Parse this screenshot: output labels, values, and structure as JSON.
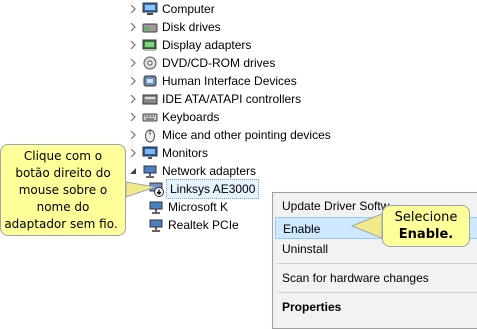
{
  "tree": {
    "items": [
      {
        "label": "Computer",
        "icon": "computer-icon",
        "expanded": false
      },
      {
        "label": "Disk drives",
        "icon": "disk-drive-icon",
        "expanded": false
      },
      {
        "label": "Display adapters",
        "icon": "display-adapter-icon",
        "expanded": false
      },
      {
        "label": "DVD/CD-ROM drives",
        "icon": "dvd-drive-icon",
        "expanded": false
      },
      {
        "label": "Human Interface Devices",
        "icon": "hid-icon",
        "expanded": false
      },
      {
        "label": "IDE ATA/ATAPI controllers",
        "icon": "ide-controller-icon",
        "expanded": false
      },
      {
        "label": "Keyboards",
        "icon": "keyboard-icon",
        "expanded": false
      },
      {
        "label": "Mice and other pointing devices",
        "icon": "mouse-icon",
        "expanded": false
      },
      {
        "label": "Monitors",
        "icon": "monitor-icon",
        "expanded": false
      },
      {
        "label": "Network adapters",
        "icon": "network-adapter-icon",
        "expanded": true
      }
    ],
    "network_children": [
      {
        "label": "Linksys AE3000",
        "icon": "disabled-adapter-icon",
        "selected": true
      },
      {
        "label": "Microsoft K",
        "icon": "network-adapter-icon",
        "selected": false
      },
      {
        "label": "Realtek PCIe",
        "icon": "network-adapter-icon",
        "selected": false
      }
    ]
  },
  "context_menu": {
    "items": [
      {
        "label": "Update Driver Softw",
        "bold": false
      },
      {
        "label": "Enable",
        "bold": false,
        "highlighted": true
      },
      {
        "label": "Uninstall",
        "bold": false
      },
      {
        "label": "Scan for hardware changes",
        "bold": false
      },
      {
        "label": "Properties",
        "bold": true
      }
    ]
  },
  "callouts": {
    "left": {
      "lines": [
        "Clique com o",
        "botão direito do",
        "mouse sobre o",
        "nome do",
        "adaptador sem fio."
      ]
    },
    "right": {
      "line1": "Selecione",
      "line2": "Enable."
    }
  },
  "colors": {
    "callout_fill": "#ffff99",
    "callout_arrow": "#e8e27a",
    "menu_highlight": "#cde8ff"
  }
}
